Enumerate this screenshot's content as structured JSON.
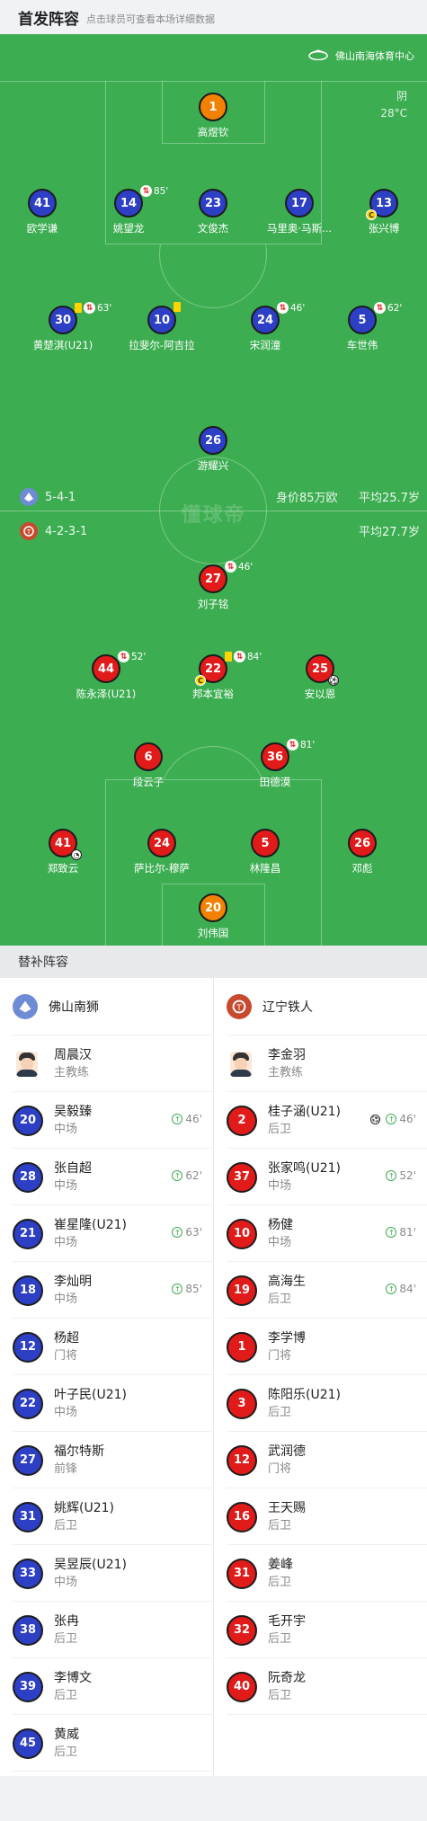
{
  "header": {
    "title": "首发阵容",
    "subtitle": "点击球员可查看本场详细数据"
  },
  "venue": {
    "name": "佛山南海体育中心",
    "weather": "阴",
    "temperature": "28°C"
  },
  "watermark": "懂球帝",
  "home_team": {
    "name": "佛山南狮",
    "formation": "5-4-1",
    "value_label": "身价85万欧",
    "avg_age_label": "平均25.7岁",
    "color": "#2d3fc4",
    "starters": [
      {
        "num": "1",
        "name": "高煜钦",
        "kit": "orange"
      },
      {
        "num": "41",
        "name": "欧学谦",
        "kit": "blue"
      },
      {
        "num": "14",
        "name": "姚望龙",
        "kit": "blue",
        "sub_min": "85'"
      },
      {
        "num": "23",
        "name": "文俊杰",
        "kit": "blue"
      },
      {
        "num": "17",
        "name": "马里奥·马斯...",
        "kit": "blue"
      },
      {
        "num": "13",
        "name": "张兴博",
        "kit": "blue",
        "captain": "C"
      },
      {
        "num": "30",
        "name": "黄楚淇(U21)",
        "kit": "blue",
        "yellow": true,
        "sub_min": "63'"
      },
      {
        "num": "10",
        "name": "拉斐尔-阿吉拉",
        "kit": "blue",
        "yellow": true
      },
      {
        "num": "24",
        "name": "宋润潼",
        "kit": "blue",
        "sub_min": "46'"
      },
      {
        "num": "5",
        "name": "车世伟",
        "kit": "blue",
        "sub_min": "62'"
      },
      {
        "num": "26",
        "name": "游耀兴",
        "kit": "blue"
      }
    ]
  },
  "away_team": {
    "name": "辽宁铁人",
    "formation": "4-2-3-1",
    "avg_age_label": "平均27.7岁",
    "color": "#e11a1a",
    "starters": [
      {
        "num": "27",
        "name": "刘子铭",
        "kit": "red",
        "sub_min": "46'"
      },
      {
        "num": "44",
        "name": "陈永泽(U21)",
        "kit": "red",
        "sub_min": "52'"
      },
      {
        "num": "22",
        "name": "邦本宜裕",
        "kit": "red",
        "yellow": true,
        "sub_min": "84'",
        "captain": "C"
      },
      {
        "num": "25",
        "name": "安以恩",
        "kit": "red",
        "goal": true
      },
      {
        "num": "6",
        "name": "段云子",
        "kit": "red"
      },
      {
        "num": "36",
        "name": "田德漠",
        "kit": "red",
        "sub_min": "81'"
      },
      {
        "num": "41",
        "name": "郑致云",
        "kit": "red",
        "assist": true
      },
      {
        "num": "24",
        "name": "萨比尔-穆萨",
        "kit": "red"
      },
      {
        "num": "5",
        "name": "林隆昌",
        "kit": "red"
      },
      {
        "num": "26",
        "name": "邓彪",
        "kit": "red"
      },
      {
        "num": "20",
        "name": "刘伟国",
        "kit": "orange"
      }
    ]
  },
  "subs_section": {
    "title": "替补阵容",
    "home": {
      "team": "佛山南狮",
      "coach": {
        "name": "周晨汉",
        "role": "主教练"
      },
      "players": [
        {
          "num": "20",
          "name": "吴毅臻",
          "pos": "中场",
          "in": "46'"
        },
        {
          "num": "28",
          "name": "张自超",
          "pos": "中场",
          "in": "62'"
        },
        {
          "num": "21",
          "name": "崔星隆(U21)",
          "pos": "中场",
          "in": "63'"
        },
        {
          "num": "18",
          "name": "李灿明",
          "pos": "中场",
          "in": "85'"
        },
        {
          "num": "12",
          "name": "杨超",
          "pos": "门将"
        },
        {
          "num": "22",
          "name": "叶子民(U21)",
          "pos": "中场"
        },
        {
          "num": "27",
          "name": "福尔特斯",
          "pos": "前锋"
        },
        {
          "num": "31",
          "name": "姚辉(U21)",
          "pos": "后卫"
        },
        {
          "num": "33",
          "name": "吴昱辰(U21)",
          "pos": "中场"
        },
        {
          "num": "38",
          "name": "张冉",
          "pos": "后卫"
        },
        {
          "num": "39",
          "name": "李博文",
          "pos": "后卫"
        },
        {
          "num": "45",
          "name": "黄威",
          "pos": "后卫"
        }
      ]
    },
    "away": {
      "team": "辽宁铁人",
      "coach": {
        "name": "李金羽",
        "role": "主教练"
      },
      "players": [
        {
          "num": "2",
          "name": "桂子涵(U21)",
          "pos": "后卫",
          "in": "46'",
          "goal": true
        },
        {
          "num": "37",
          "name": "张家鸣(U21)",
          "pos": "中场",
          "in": "52'"
        },
        {
          "num": "10",
          "name": "杨健",
          "pos": "中场",
          "in": "81'"
        },
        {
          "num": "19",
          "name": "高海生",
          "pos": "后卫",
          "in": "84'"
        },
        {
          "num": "1",
          "name": "李学博",
          "pos": "门将"
        },
        {
          "num": "3",
          "name": "陈阳乐(U21)",
          "pos": "后卫"
        },
        {
          "num": "12",
          "name": "武润德",
          "pos": "门将"
        },
        {
          "num": "16",
          "name": "王天赐",
          "pos": "后卫"
        },
        {
          "num": "31",
          "name": "姜峰",
          "pos": "后卫"
        },
        {
          "num": "32",
          "name": "毛开宇",
          "pos": "后卫"
        },
        {
          "num": "40",
          "name": "阮奇龙",
          "pos": "后卫"
        }
      ]
    }
  }
}
